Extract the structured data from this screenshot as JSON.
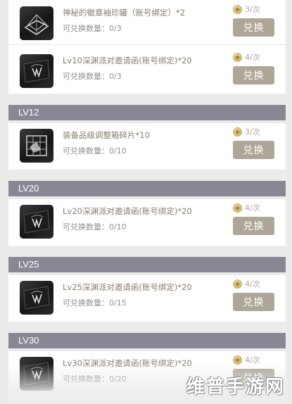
{
  "section_top": {
    "items": [
      {
        "name": "神秘的徽章袖珍罐（账号绑定）*2",
        "qty_label": "可兑换数量：0/3",
        "price": "3/次",
        "button": "兑换",
        "icon": "badge-jar-icon"
      },
      {
        "name": "Lv10深渊派对邀请函(账号绑定)*20",
        "qty_label": "可兑换数量：0/3",
        "price": "4/次",
        "button": "兑换",
        "icon": "invitation-card-icon"
      }
    ]
  },
  "sections": [
    {
      "title": "LV12",
      "items": [
        {
          "name": "装备品级调整箱碎片*10",
          "qty_label": "可兑换数量：0/10",
          "price": "3/次",
          "button": "兑换",
          "icon": "equipment-box-fragment-icon"
        }
      ]
    },
    {
      "title": "LV20",
      "items": [
        {
          "name": "Lv20深渊派对邀请函(账号绑定)*20",
          "qty_label": "可兑换数量：0/10",
          "price": "4/次",
          "button": "兑换",
          "icon": "invitation-card-icon"
        }
      ]
    },
    {
      "title": "LV25",
      "items": [
        {
          "name": "Lv25深渊派对邀请函(账号绑定)*20",
          "qty_label": "可兑换数量：0/15",
          "price": "4/次",
          "button": "兑换",
          "icon": "invitation-card-icon"
        }
      ]
    },
    {
      "title": "LV30",
      "items": [
        {
          "name": "Lv30深渊派对邀请函(账号绑定)*20",
          "qty_label": "可兑换数量：0/20",
          "price": "4/次",
          "button": "兑换",
          "icon": "invitation-card-icon"
        }
      ]
    }
  ],
  "currency_icon": "gold-coin-icon",
  "watermark": "维普手游网",
  "colors": {
    "section_header": "#8a8794",
    "button": "#aea697",
    "item_name": "#8a7d70",
    "background": "#ebebeb"
  }
}
